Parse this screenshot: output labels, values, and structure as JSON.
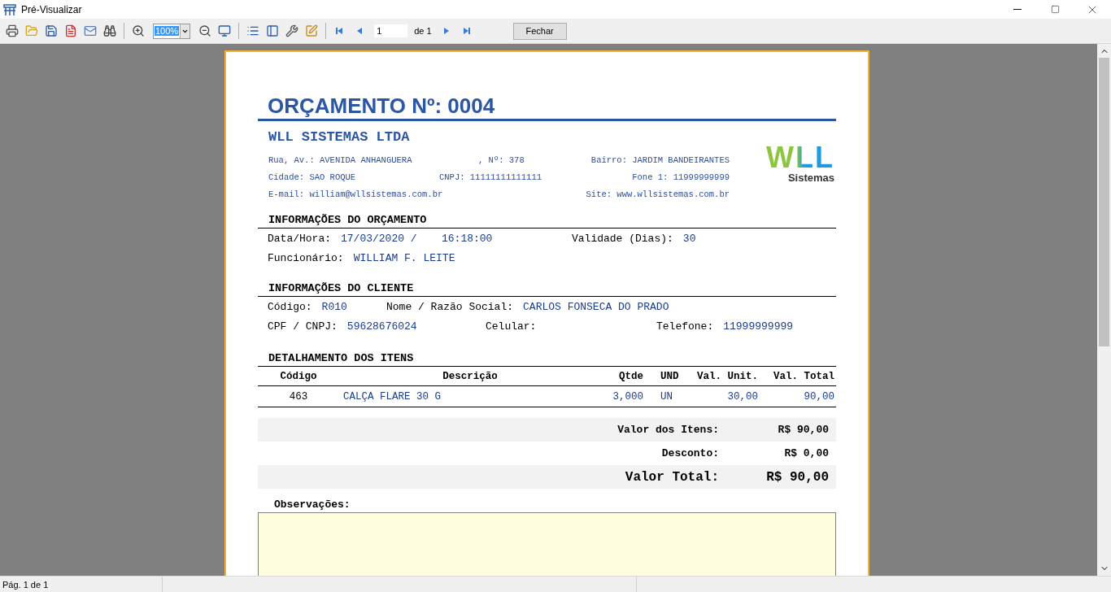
{
  "window": {
    "title": "Pré-Visualizar"
  },
  "toolbar": {
    "zoom": "100%",
    "page": "1",
    "page_count": "de 1",
    "close_button": "Fechar"
  },
  "document": {
    "title": "ORÇAMENTO Nº: 0004",
    "company": {
      "name": "WLL SISTEMAS LTDA",
      "rows": [
        {
          "left": "Rua, Av.: AVENIDA ANHANGUERA",
          "middle": ", Nº: 378",
          "right": "Bairro: JARDIM BANDEIRANTES"
        },
        {
          "left": "Cidade: SAO ROQUE",
          "middle": "CNPJ: 11111111111111",
          "right": "Fone 1: 11999999999"
        },
        {
          "left": "E-mail: william@wllsistemas.com.br",
          "right": "Site: www.wllsistemas.com.br"
        }
      ]
    },
    "logo": {
      "mark": "WLL",
      "caption": "Sistemas"
    },
    "sections": [
      {
        "heading": "INFORMAÇÕES DO ORÇAMENTO",
        "rows": [
          [
            {
              "label": "Data/Hora:",
              "value": "17/03/2020 /"
            },
            {
              "value": "16:18:00"
            },
            {
              "label": "Validade (Dias):",
              "value": "30"
            }
          ],
          [
            {
              "label": "Funcionário:",
              "value": "WILLIAM F. LEITE"
            }
          ]
        ]
      },
      {
        "heading": "INFORMAÇÕES DO CLIENTE",
        "rows": [
          [
            {
              "label": "Código:",
              "value": "R010"
            },
            {
              "label": "Nome / Razão Social:",
              "value": "CARLOS FONSECA DO PRADO"
            }
          ],
          [
            {
              "label": "CPF / CNPJ:",
              "value": "59628676024"
            },
            {
              "label": "Celular:"
            },
            {
              "label": "Telefone:",
              "value": "11999999999"
            }
          ]
        ]
      }
    ],
    "items": {
      "heading": "DETALHAMENTO DOS ITENS",
      "columns": [
        "Código",
        "Descrição",
        "Qtde",
        "UND",
        "Val. Unit.",
        "Val. Total"
      ],
      "rows": [
        [
          "463",
          "CALÇA FLARE 30 G",
          "3,000",
          "UN",
          "30,00",
          "90,00"
        ]
      ]
    },
    "totals": [
      {
        "kind": "line",
        "label": "Valor dos Itens:",
        "value": "R$ 90,00"
      },
      {
        "kind": "line",
        "label": "Desconto:",
        "value": "R$ 0,00"
      },
      {
        "kind": "grand",
        "label": "Valor Total:",
        "value": "R$ 90,00"
      }
    ],
    "notes": {
      "label": "Observações:"
    }
  },
  "status_bar": {
    "text": "Pág. 1 de 1"
  }
}
